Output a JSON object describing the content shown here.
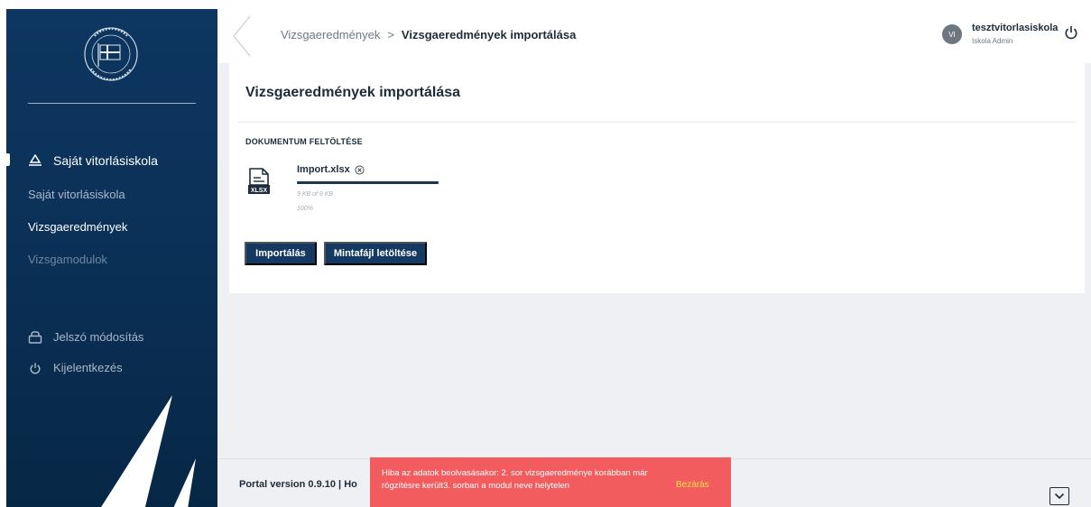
{
  "sidebar": {
    "section_title": "Saját vitorlásiskola",
    "items": [
      "Saját vitorlásiskola",
      "Vizsgaeredmények",
      "Vizsgamodulok"
    ],
    "password_change": "Jelszó módosítás",
    "logout": "Kijelentkezés"
  },
  "header": {
    "breadcrumb_parent": "Vizsgaeredmények",
    "breadcrumb_separator": ">",
    "breadcrumb_current": "Vizsgaeredmények importálása",
    "avatar_initials": "VI",
    "user_name": "tesztvitorlasiskola",
    "user_role": "Iskola Admin"
  },
  "card": {
    "title": "Vizsgaeredmények importálása",
    "section_label": "DOKUMENTUM FELTÖLTÉSE",
    "file_badge": "XLSX",
    "file_name": "Import.xlsx",
    "file_size": "9 KB of 9 KB",
    "file_percent": "100%",
    "progress": 1.0,
    "import_button": "Importálás",
    "template_button": "Mintafájl letöltése"
  },
  "footer": {
    "text": "Portal version 0.9.10 | Ho"
  },
  "toast": {
    "message": "Hiba az adatok beolvasásakor: 2. sor vizsgaeredménye korábban már rögzítésre került3. sorban a modul neve helytelen",
    "close_label": "Bezárás"
  },
  "icons": {
    "sidebar_header": "sailboat-icon",
    "password": "lock-icon",
    "logout": "power-icon",
    "file": "xlsx-file-icon",
    "remove": "close-circle-icon",
    "back": "chevron-left-icon",
    "footer": "chevron-down-icon"
  },
  "colors": {
    "sidebar": "#0d3660",
    "primary_button": "#143a63",
    "toast_bg": "#f25c5e",
    "toast_close": "#f4e04d",
    "content_bg": "#eef0f3"
  }
}
